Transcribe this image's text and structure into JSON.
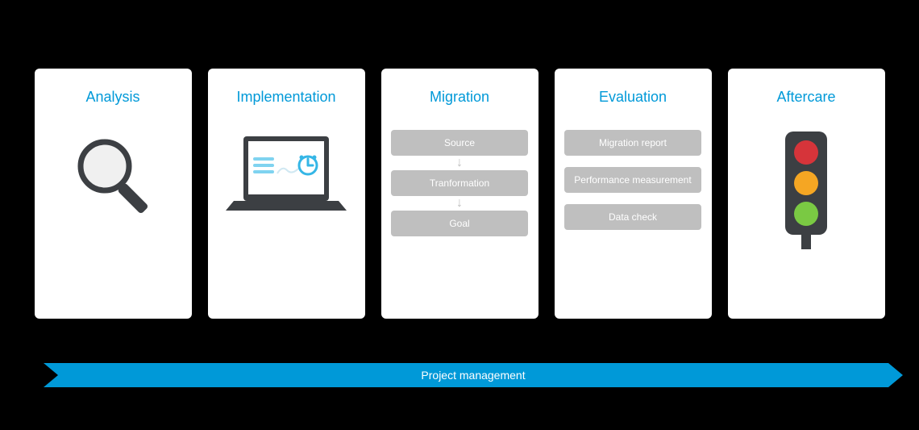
{
  "cards": [
    {
      "title": "Analysis"
    },
    {
      "title": "Implementation"
    },
    {
      "title": "Migration",
      "steps": [
        "Source",
        "Tranformation",
        "Goal"
      ]
    },
    {
      "title": "Evaluation",
      "items": [
        "Migration report",
        "Performance measurement",
        "Data check"
      ]
    },
    {
      "title": "Aftercare"
    }
  ],
  "banner": {
    "label": "Project management"
  },
  "colors": {
    "accent": "#0099d8",
    "pill": "#bfbfbf",
    "tl_body": "#3c3f43",
    "red": "#d6343a",
    "amber": "#f5a623",
    "green": "#7ac943"
  }
}
